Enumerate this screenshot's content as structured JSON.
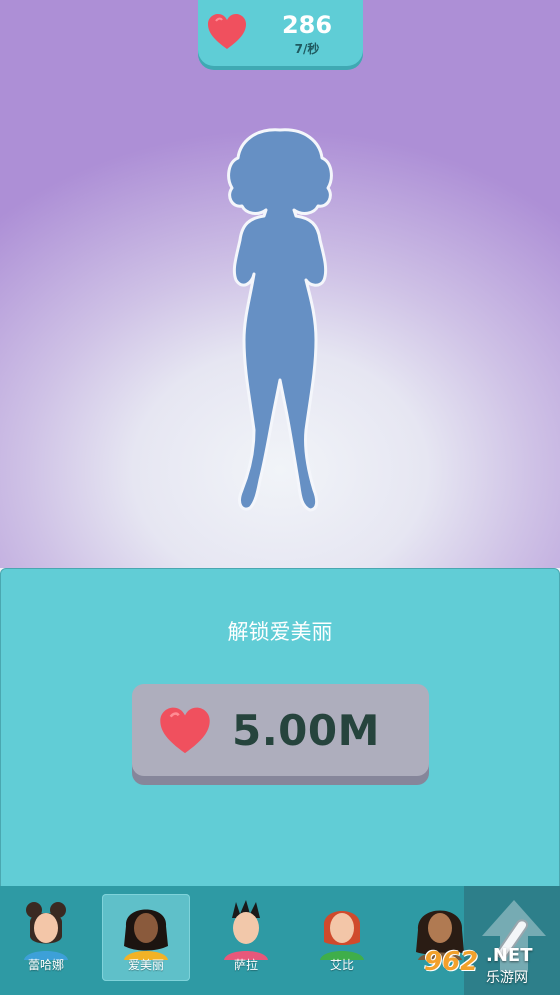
{
  "hud": {
    "hearts_total": "286",
    "hearts_rate": "7/秒",
    "heart_icon": "heart-icon"
  },
  "scene": {
    "locked_character": "silhouette"
  },
  "unlock_panel": {
    "title": "解锁爱美丽",
    "price": "5.00M",
    "price_icon": "heart-icon"
  },
  "characters": [
    {
      "name": "蕾哈娜",
      "selected": false
    },
    {
      "name": "爱美丽",
      "selected": true
    },
    {
      "name": "萨拉",
      "selected": false
    },
    {
      "name": "艾比",
      "selected": false
    },
    {
      "name": "",
      "selected": false
    }
  ],
  "watermark": {
    "number": "962",
    "suffix": ".NET",
    "site": "乐游网"
  },
  "colors": {
    "accent": "#5fcdd6",
    "heart": "#f0505e",
    "price_text": "#26443d",
    "silhouette": "#6690c4"
  }
}
